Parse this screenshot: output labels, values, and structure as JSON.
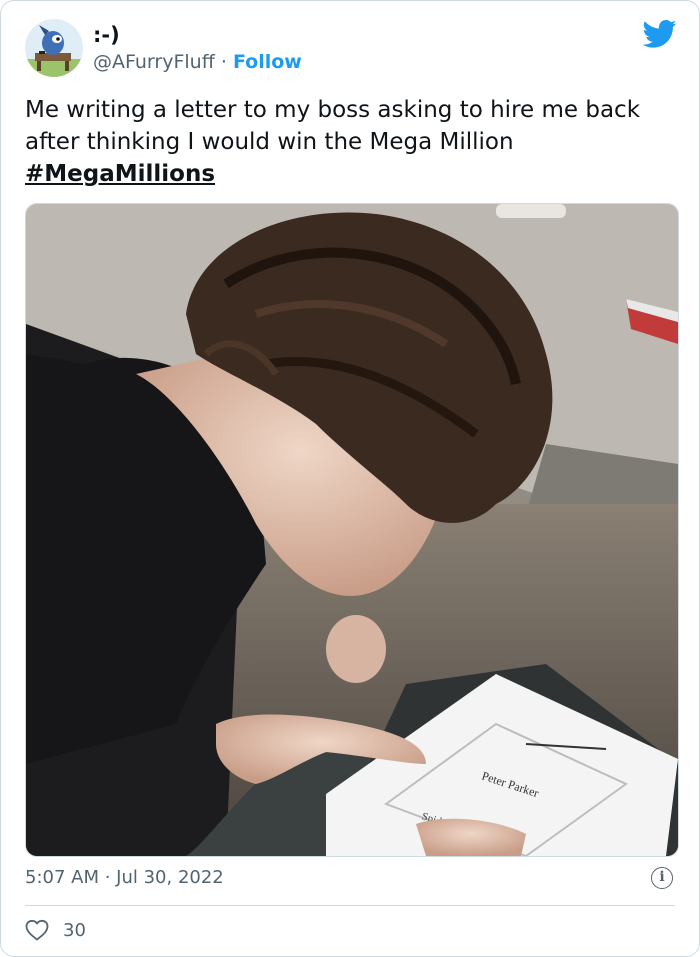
{
  "tweet": {
    "display_name": ":-)",
    "handle": "@AFurryFluff",
    "separator": " · ",
    "follow_label": "Follow",
    "text": "Me writing a letter to my boss asking to hire me back after thinking I would win the Mega Million",
    "hashtag": "#MegaMillions",
    "timestamp": "5:07 AM · Jul 30, 2022",
    "like_count": "30",
    "info_glyph": "i"
  },
  "icons": {
    "brand": "twitter-bird-icon",
    "info": "info-icon",
    "like": "heart-icon"
  },
  "colors": {
    "accent": "#1d9bf0",
    "text": "#0f1419",
    "muted": "#536471",
    "border": "#cfd9de"
  },
  "media": {
    "description_type": "photo",
    "paper_texts": [
      "Peter Parker",
      "Spid"
    ]
  }
}
